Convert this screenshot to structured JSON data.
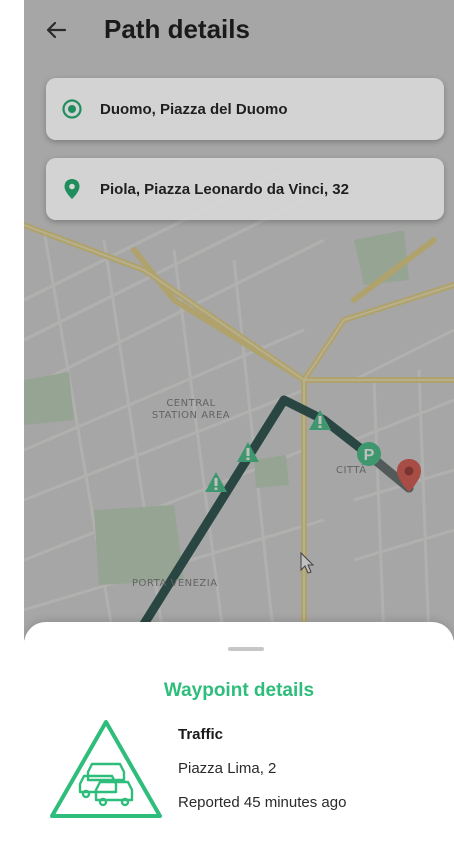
{
  "header": {
    "back_icon": "arrow-left-icon",
    "title": "Path details"
  },
  "route": {
    "origin": {
      "label": "Duomo, Piazza del Duomo",
      "icon": "origin-target-icon"
    },
    "destination": {
      "label": "Piola, Piazza Leonardo da Vinci, 32",
      "icon": "location-pin-icon"
    }
  },
  "map": {
    "area_labels": [
      {
        "text": "CENTRAL\nSTATION AREA"
      },
      {
        "text": "CITTÀ"
      },
      {
        "text": "PORTA VENEZIA"
      }
    ],
    "markers": [
      "traffic-warning-icon",
      "traffic-warning-icon",
      "traffic-warning-icon",
      "parking-icon",
      "destination-pin-icon"
    ]
  },
  "waypoint": {
    "section_title": "Waypoint details",
    "type": "Traffic",
    "address": "Piazza Lima, 2",
    "reported": "Reported 45 minutes ago",
    "icon": "traffic-jam-icon"
  },
  "colors": {
    "accent": "#2ebd7b",
    "route_line": "#0e3b34",
    "pin": "#d9453a"
  }
}
